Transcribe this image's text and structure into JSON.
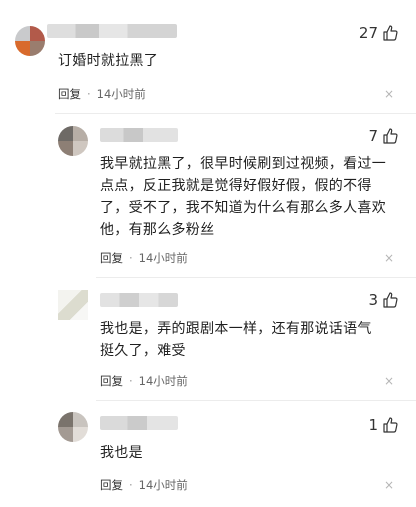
{
  "comments": [
    {
      "text_lines": [
        "订婚时就拉黑了"
      ],
      "likes": "27",
      "reply_label": "回复",
      "separator": "·",
      "time": "14小时前",
      "close_glyph": "×"
    },
    {
      "text_lines": [
        "我早就拉黑了，很早时候刷到过视频，看过一",
        "点点，反正我就是觉得好假好假，假的不得",
        "了，受不了，我不知道为什么有那么多人喜欢",
        "他，有那么多粉丝"
      ],
      "likes": "7",
      "reply_label": "回复",
      "separator": "·",
      "time": "14小时前",
      "close_glyph": "×"
    },
    {
      "text_lines": [
        "我也是，弄的跟剧本一样，还有那说话语气",
        "挺久了，难受"
      ],
      "likes": "3",
      "reply_label": "回复",
      "separator": "·",
      "time": "14小时前",
      "close_glyph": "×"
    },
    {
      "text_lines": [
        "我也是"
      ],
      "likes": "1",
      "reply_label": "回复",
      "separator": "·",
      "time": "14小时前",
      "close_glyph": "×"
    }
  ],
  "colors": {
    "text": "#1f1f1f",
    "meta": "#666666",
    "divider": "#ececec",
    "blur_gray": "#d9d9d9"
  },
  "icons": {
    "like": "thumbs-up-icon",
    "close": "close-icon"
  }
}
